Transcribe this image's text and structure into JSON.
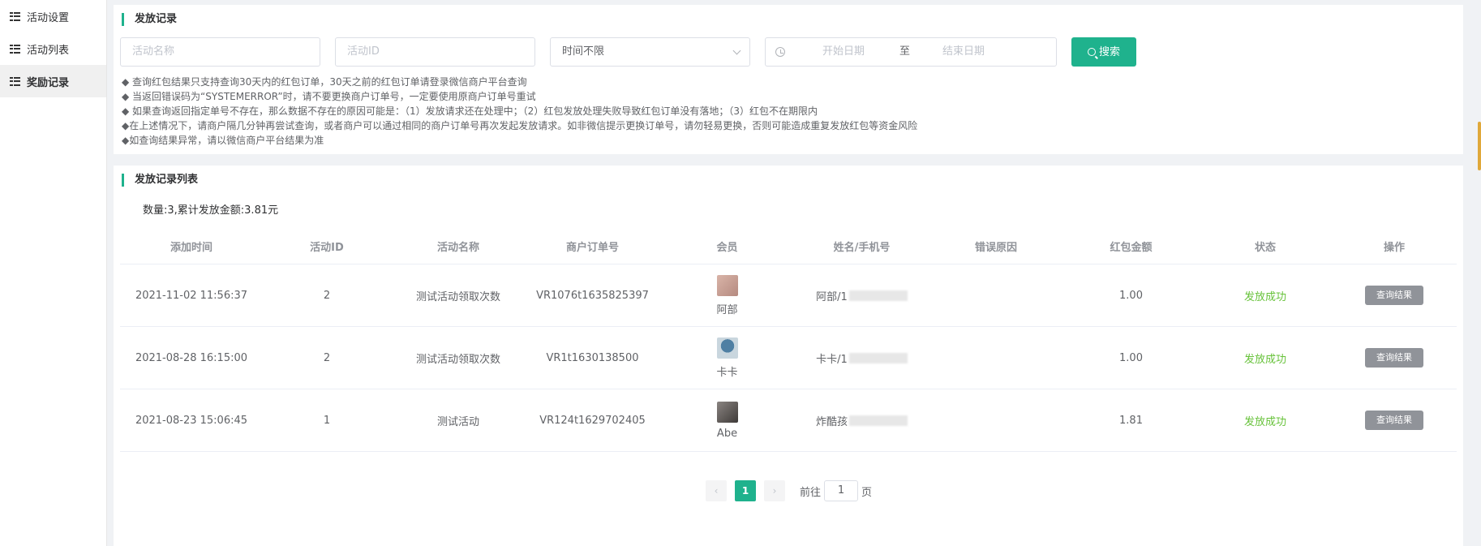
{
  "sidebar": {
    "items": [
      {
        "label": "活动设置"
      },
      {
        "label": "活动列表"
      },
      {
        "label": "奖励记录"
      }
    ]
  },
  "filter_panel": {
    "title": "发放记录",
    "activity_name_placeholder": "活动名称",
    "activity_id_placeholder": "活动ID",
    "time_select_value": "时间不限",
    "start_date_placeholder": "开始日期",
    "date_separator": "至",
    "end_date_placeholder": "结束日期",
    "search_label": "搜索",
    "notes": [
      "◆ 查询红包结果只支持查询30天内的红包订单，30天之前的红包订单请登录微信商户平台查询",
      "◆ 当返回错误码为“SYSTEMERROR”时，请不要更换商户订单号，一定要使用原商户订单号重试",
      "◆ 如果查询返回指定单号不存在，那么数据不存在的原因可能是：（1）发放请求还在处理中；（2）红包发放处理失败导致红包订单没有落地；（3）红包不在期限内",
      "◆在上述情况下，请商户隔几分钟再尝试查询，或者商户可以通过相同的商户订单号再次发起发放请求。如非微信提示更换订单号，请勿轻易更换，否则可能造成重复发放红包等资金风险",
      "◆如查询结果异常，请以微信商户平台结果为准"
    ]
  },
  "list_panel": {
    "title": "发放记录列表",
    "summary": "数量:3,累计发放金额:3.81元",
    "columns": [
      "添加时间",
      "活动ID",
      "活动名称",
      "商户订单号",
      "会员",
      "姓名/手机号",
      "错误原因",
      "红包金额",
      "状态",
      "操作"
    ],
    "rows": [
      {
        "time": "2021-11-02 11:56:37",
        "activity_id": "2",
        "activity_name": "测试活动领取次数",
        "order_no": "VR1076t1635825397",
        "member": "阿部",
        "name_phone": "阿部/1",
        "error": "",
        "amount": "1.00",
        "status": "发放成功",
        "op": "查询结果"
      },
      {
        "time": "2021-08-28 16:15:00",
        "activity_id": "2",
        "activity_name": "测试活动领取次数",
        "order_no": "VR1t1630138500",
        "member": "卡卡",
        "name_phone": "卡卡/1",
        "error": "",
        "amount": "1.00",
        "status": "发放成功",
        "op": "查询结果"
      },
      {
        "time": "2021-08-23 15:06:45",
        "activity_id": "1",
        "activity_name": "测试活动",
        "order_no": "VR124t1629702405",
        "member": "Abe",
        "name_phone": "炸酷孩",
        "error": "",
        "amount": "1.81",
        "status": "发放成功",
        "op": "查询结果"
      }
    ]
  },
  "pagination": {
    "prev": "‹",
    "current": "1",
    "next": "›",
    "goto_label": "前往",
    "goto_value": "1",
    "page_unit": "页"
  },
  "colors": {
    "accent": "#1fb28d",
    "success": "#67c23a",
    "button_gray": "#909399"
  }
}
